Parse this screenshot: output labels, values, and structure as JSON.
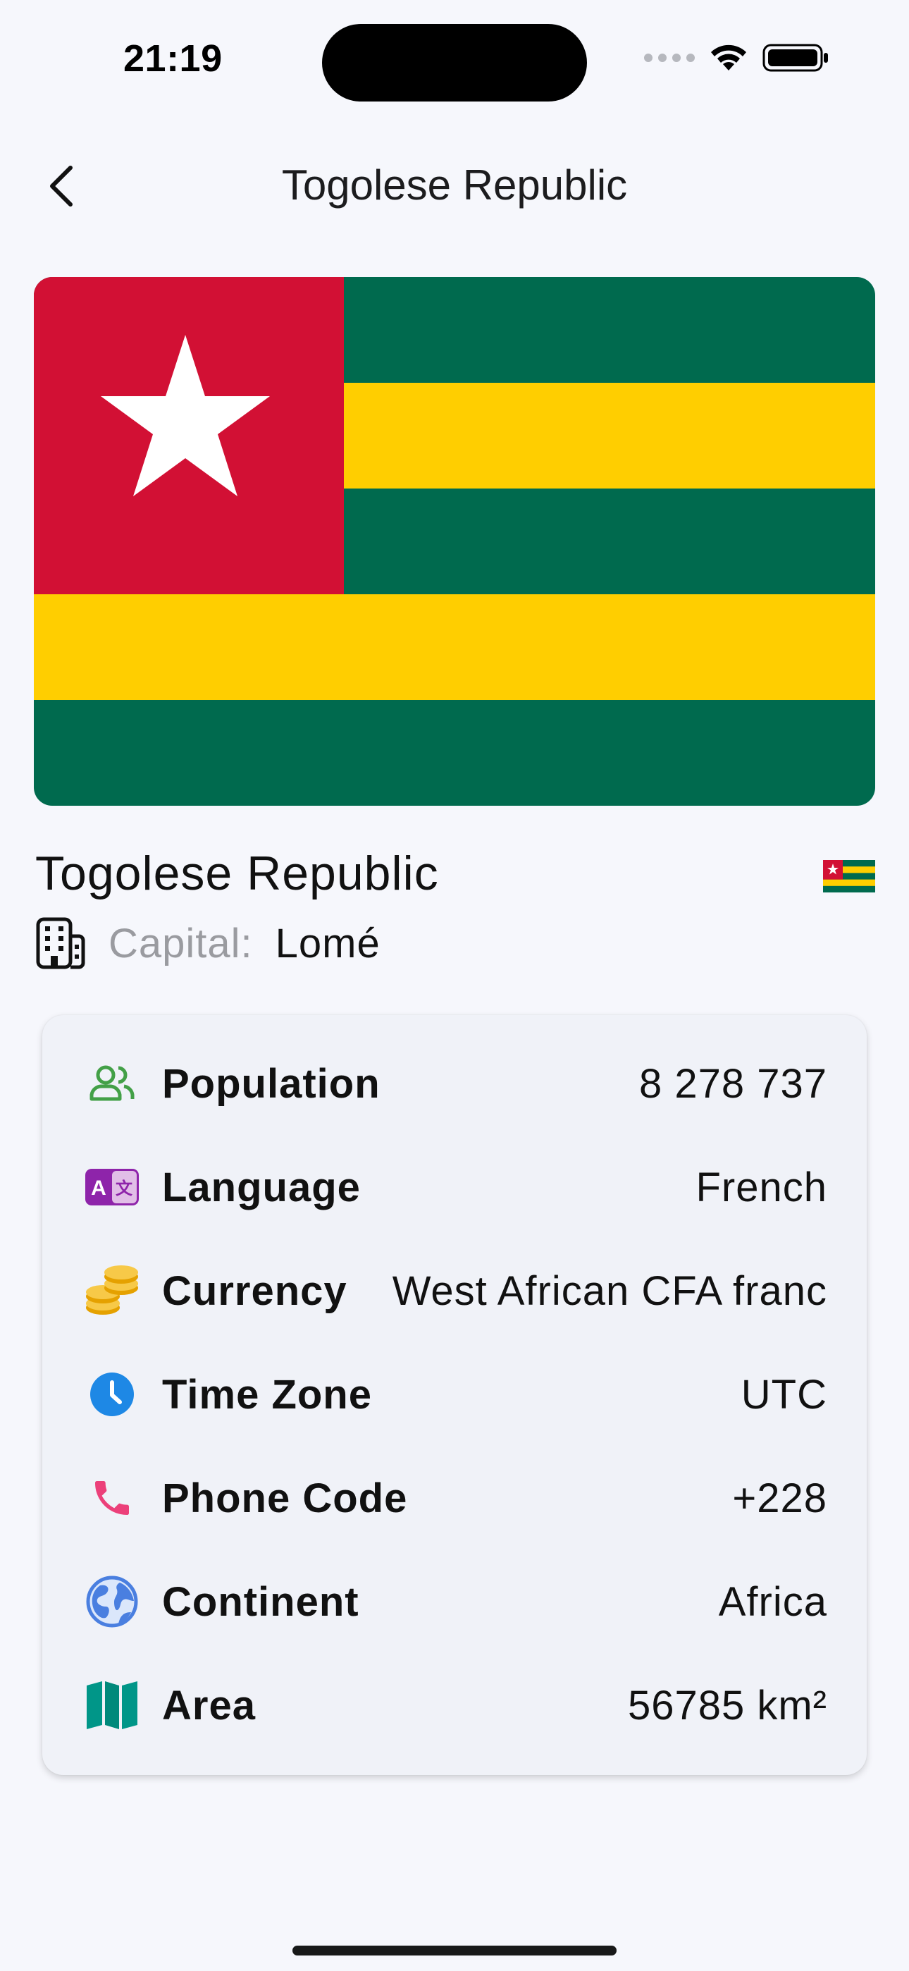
{
  "status_bar": {
    "time": "21:19"
  },
  "nav": {
    "title": "Togolese Republic",
    "back_icon": "chevron-left-icon"
  },
  "flag": {
    "colors": {
      "red": "#d21034",
      "yellow": "#ffce00",
      "green": "#006a4e",
      "star": "#ffffff"
    }
  },
  "country": {
    "name": "Togolese Republic",
    "capital_label": "Capital:",
    "capital_value": "Lomé"
  },
  "info": {
    "rows": [
      {
        "icon": "people-icon",
        "label": "Population",
        "value": "8 278 737",
        "color": "#43a047"
      },
      {
        "icon": "translate-icon",
        "label": "Language",
        "value": "French",
        "color": "#8e24aa"
      },
      {
        "icon": "coins-icon",
        "label": "Currency",
        "value": "West African CFA franc",
        "color": "#f2b705"
      },
      {
        "icon": "clock-icon",
        "label": "Time Zone",
        "value": "UTC",
        "color": "#1e88e5"
      },
      {
        "icon": "phone-icon",
        "label": "Phone Code",
        "value": "+228",
        "color": "#ec407a"
      },
      {
        "icon": "globe-icon",
        "label": "Continent",
        "value": "Africa",
        "color": "#4a7fe0"
      },
      {
        "icon": "map-icon",
        "label": "Area",
        "value": "56785 km²",
        "color": "#009688"
      }
    ]
  }
}
